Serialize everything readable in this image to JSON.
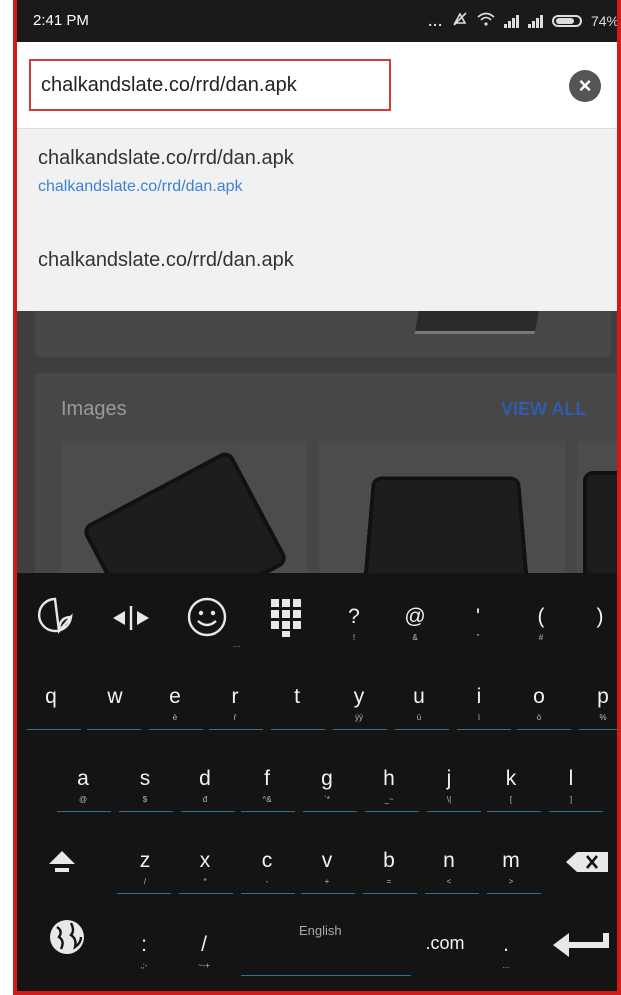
{
  "status_bar": {
    "time": "2:41 PM",
    "dots": "...",
    "battery": "74%"
  },
  "address_bar": {
    "url": "chalkandslate.co/rrd/dan.apk",
    "clear_icon": "clear-icon"
  },
  "suggestions": [
    {
      "title": "chalkandslate.co/rrd/dan.apk",
      "subtitle": "chalkandslate.co/rrd/dan.apk"
    },
    {
      "title": "chalkandslate.co/rrd/dan.apk"
    }
  ],
  "page": {
    "images_label": "Images",
    "view_all": "VIEW ALL"
  },
  "keyboard": {
    "symbol_row": [
      {
        "label": "?",
        "hint": "!"
      },
      {
        "label": "@",
        "hint": "&"
      },
      {
        "label": "'",
        "hint": "\""
      },
      {
        "label": "(",
        "hint": "#"
      },
      {
        "label": ")",
        "hint": ""
      }
    ],
    "row1": [
      {
        "label": "q",
        "hint": ""
      },
      {
        "label": "w",
        "hint": ""
      },
      {
        "label": "e",
        "hint": "è"
      },
      {
        "label": "r",
        "hint": "ŕ"
      },
      {
        "label": "t",
        "hint": ""
      },
      {
        "label": "y",
        "hint": "ýÿ"
      },
      {
        "label": "u",
        "hint": "ü"
      },
      {
        "label": "i",
        "hint": "ì"
      },
      {
        "label": "o",
        "hint": "ö"
      },
      {
        "label": "p",
        "hint": "%"
      }
    ],
    "row2": [
      {
        "label": "a",
        "hint": "@"
      },
      {
        "label": "s",
        "hint": "$"
      },
      {
        "label": "d",
        "hint": "đ"
      },
      {
        "label": "f",
        "hint": "^&"
      },
      {
        "label": "g",
        "hint": "`*"
      },
      {
        "label": "h",
        "hint": "_~"
      },
      {
        "label": "j",
        "hint": "\\|"
      },
      {
        "label": "k",
        "hint": "["
      },
      {
        "label": "l",
        "hint": "]"
      }
    ],
    "row3": [
      {
        "label": "z",
        "hint": "/"
      },
      {
        "label": "x",
        "hint": "*"
      },
      {
        "label": "c",
        "hint": "-"
      },
      {
        "label": "v",
        "hint": "+"
      },
      {
        "label": "b",
        "hint": "="
      },
      {
        "label": "n",
        "hint": "<"
      },
      {
        "label": "m",
        "hint": ">"
      }
    ],
    "bottom": {
      "colon": ":",
      "colon_hint": ",;-",
      "slash": "/",
      "slash_hint": "~-+",
      "space_label": "English",
      "dotcom": ".com",
      "period": ".",
      "period_hint": "..."
    },
    "toolbar_icons": [
      "sticker-icon",
      "cursor-move-icon",
      "emoji-icon",
      "numpad-icon"
    ],
    "emoji_hint": "..."
  }
}
